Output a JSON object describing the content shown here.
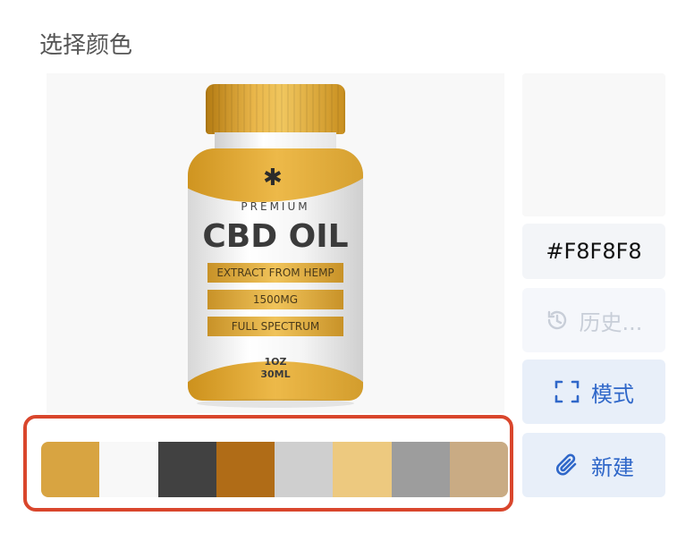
{
  "panel": {
    "title": "选择颜色"
  },
  "product": {
    "premium": "PREMIUM",
    "brand": "CBD OIL",
    "band1": "EXTRACT FROM HEMP",
    "band2": "1500MG",
    "band3": "FULL SPECTRUM",
    "dose_line1": "1OZ",
    "dose_line2": "30ML"
  },
  "selected_color": {
    "hex": "#F8F8F8"
  },
  "buttons": {
    "history": {
      "label": "历史...",
      "icon": "history-icon",
      "enabled": false
    },
    "mode": {
      "label": "模式",
      "icon": "scan-frame-icon"
    },
    "new": {
      "label": "新建",
      "icon": "paperclip-icon"
    }
  },
  "palette": [
    "#D8A441",
    "#F8F8F8",
    "#414141",
    "#B06C17",
    "#CFCFCF",
    "#EDC97F",
    "#9D9D9D",
    "#C9AB84"
  ],
  "colors": {
    "highlight_border": "#D9462C",
    "accent": "#2F67C9"
  }
}
